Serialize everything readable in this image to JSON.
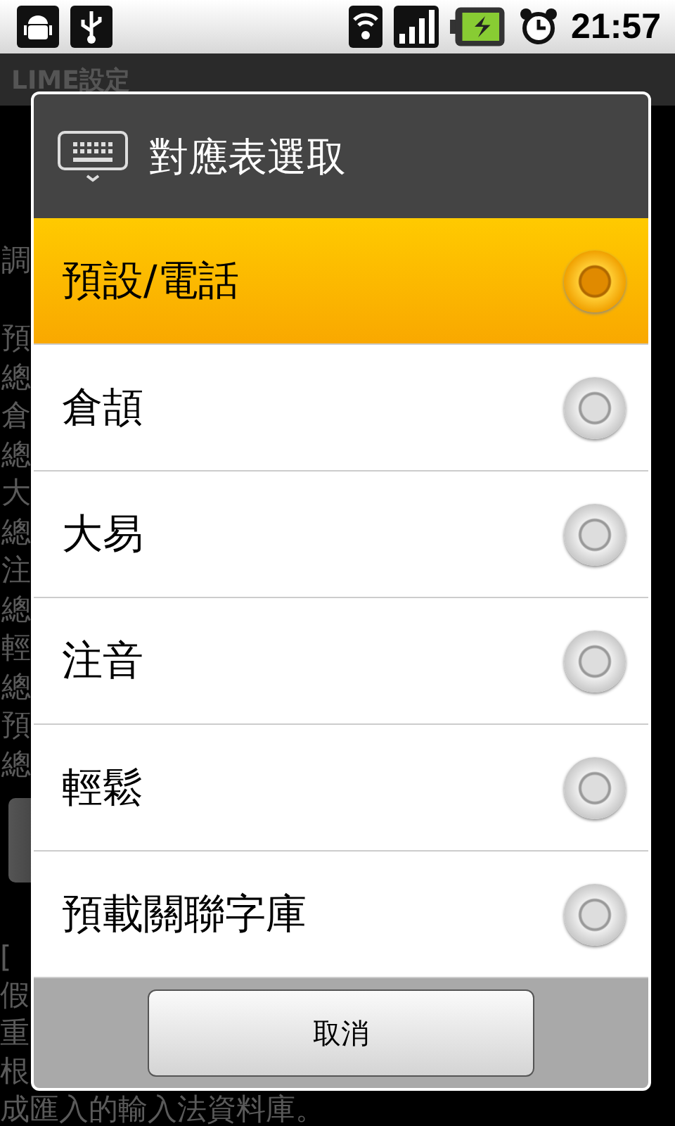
{
  "status_bar": {
    "time": "21:57"
  },
  "app": {
    "title": "LIME設定",
    "side_heading": "調",
    "side_letters": [
      "預",
      "總",
      "倉",
      "總",
      "大",
      "總",
      "注",
      "總",
      "輕",
      "總",
      "預",
      "總"
    ],
    "footer_lines": [
      "[",
      "假",
      "重",
      "根",
      "成匯入的輸入法資料庫。"
    ]
  },
  "dialog": {
    "title": "對應表選取",
    "options": [
      {
        "label": "預設/電話",
        "selected": true
      },
      {
        "label": "倉頡",
        "selected": false
      },
      {
        "label": "大易",
        "selected": false
      },
      {
        "label": "注音",
        "selected": false
      },
      {
        "label": "輕鬆",
        "selected": false
      },
      {
        "label": "預載關聯字庫",
        "selected": false
      }
    ],
    "cancel_button": "取消"
  }
}
